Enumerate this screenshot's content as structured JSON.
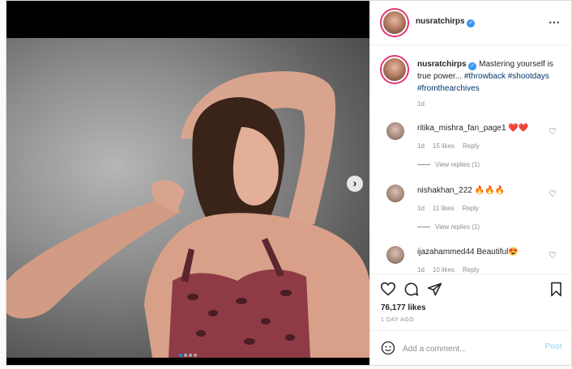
{
  "post": {
    "author": "nusratchirps",
    "caption_main": "Mastering yourself is true power... ",
    "hashtags": "#throwback #shootdays #fromthearchives",
    "caption_time": "1d",
    "likes": "76,177 likes",
    "posted_ago": "1 DAY AGO",
    "carousel": {
      "slide": 1,
      "total": 4
    }
  },
  "comments": [
    {
      "user": "ritika_mishra_fan_page1",
      "text": "❤️❤️",
      "time": "1d",
      "likes": "15 likes",
      "reply": "Reply",
      "view_replies": "View replies (1)"
    },
    {
      "user": "nishakhan_222",
      "text": "🔥🔥🔥",
      "time": "1d",
      "likes": "11 likes",
      "reply": "Reply",
      "view_replies": "View replies (1)"
    },
    {
      "user": "ijazahammed44",
      "text": "Beautiful😍",
      "time": "1d",
      "likes": "10 likes",
      "reply": "Reply"
    }
  ],
  "composer": {
    "placeholder": "Add a comment...",
    "post_label": "Post"
  },
  "icons": {
    "more": "⋯",
    "next": "›",
    "heart": "heart-icon",
    "comment": "comment-icon",
    "share": "share-icon",
    "save": "bookmark-icon",
    "emoji": "emoji-icon"
  }
}
